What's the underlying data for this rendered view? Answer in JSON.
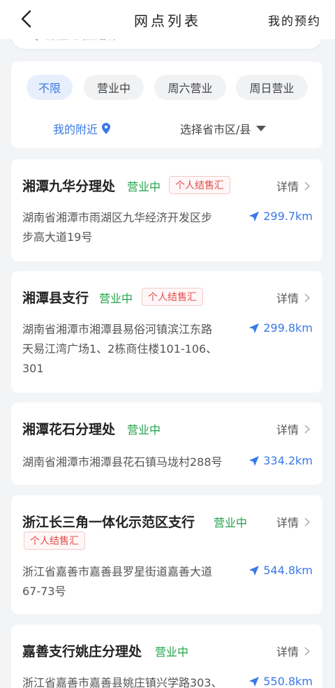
{
  "header": {
    "title": "网点列表",
    "my_appointment": "我的预约"
  },
  "search": {
    "placeholder": "请输入网点名称"
  },
  "filters": {
    "chips": [
      "不限",
      "营业中",
      "周六营业",
      "周日营业"
    ],
    "active_index": 0,
    "nearby_label": "我的附近",
    "region_label": "选择省市区/县"
  },
  "colors": {
    "accent": "#3a78e5",
    "open": "#22a34a",
    "tag": "#e14c4c"
  },
  "branches": [
    {
      "name": "湘潭九华分理处",
      "status": "营业中",
      "tag": "个人结售汇",
      "detail": "详情",
      "address_line1": "湖南省湘潭市雨湖区九华经济开发区步",
      "address_line2": "步高大道19号",
      "address_line3": "",
      "distance": "299.7km"
    },
    {
      "name": "湘潭县支行",
      "status": "营业中",
      "tag": "个人结售汇",
      "detail": "详情",
      "address_line1": "湖南省湘潭市湘潭县易俗河镇滨江东路",
      "address_line2": "天易江湾广场1、2栋商住楼101-106、",
      "address_line3": "301",
      "distance": "299.8km"
    },
    {
      "name": "湘潭花石分理处",
      "status": "营业中",
      "tag": "",
      "detail": "详情",
      "address_line1": "湖南省湘潭市湘潭县花石镇马垅村288号",
      "address_line2": "",
      "address_line3": "",
      "distance": "334.2km"
    },
    {
      "name": "浙江长三角一体化示范区支行",
      "status": "营业中",
      "tag": "个人结售汇",
      "detail": "详情",
      "address_line1": "浙江省嘉善市嘉善县罗星街道嘉善大道",
      "address_line2": "67-73号",
      "address_line3": "",
      "distance": "544.8km"
    },
    {
      "name": "嘉善支行姚庄分理处",
      "status": "营业中",
      "tag": "",
      "detail": "详情",
      "address_line1": "浙江省嘉善市嘉善县姚庄镇兴学路303、",
      "address_line2": "",
      "address_line3": "",
      "distance": "550.8km"
    }
  ]
}
